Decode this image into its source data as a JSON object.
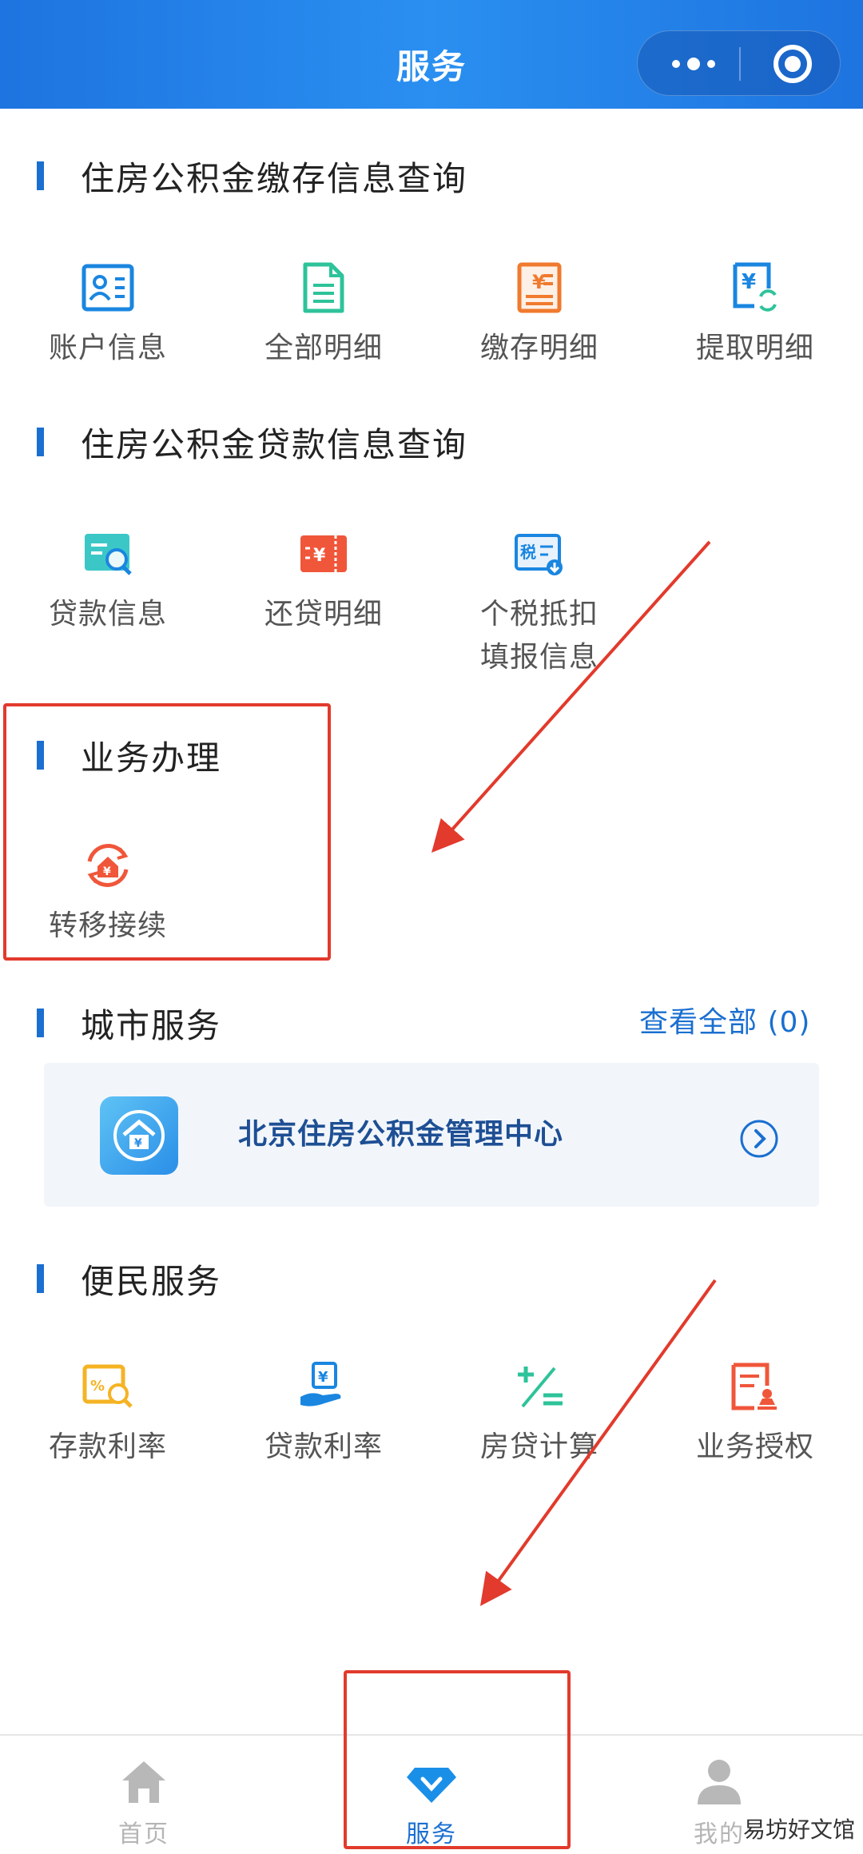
{
  "header": {
    "title": "服务"
  },
  "sections": {
    "deposit": {
      "title": "住房公积金缴存信息查询",
      "items": [
        {
          "label": "账户信息",
          "icon": "account-card-icon"
        },
        {
          "label": "全部明细",
          "icon": "document-icon"
        },
        {
          "label": "缴存明细",
          "icon": "yuan-ledger-icon"
        },
        {
          "label": "提取明细",
          "icon": "yuan-refresh-icon"
        }
      ]
    },
    "loan": {
      "title": "住房公积金贷款信息查询",
      "items": [
        {
          "label": "贷款信息",
          "icon": "search-card-icon"
        },
        {
          "label": "还贷明细",
          "icon": "yuan-ticket-icon"
        },
        {
          "label": "个税抵扣",
          "label2": "填报信息",
          "icon": "tax-download-icon"
        }
      ]
    },
    "business": {
      "title": "业务办理",
      "items": [
        {
          "label": "转移接续",
          "icon": "transfer-house-icon"
        }
      ]
    },
    "city": {
      "title": "城市服务",
      "view_all": "查看全部 (0)",
      "card_name": "北京住房公积金管理中心"
    },
    "convenience": {
      "title": "便民服务",
      "items": [
        {
          "label": "存款利率",
          "icon": "rate-search-icon"
        },
        {
          "label": "贷款利率",
          "icon": "loan-hand-icon"
        },
        {
          "label": "房贷计算",
          "icon": "calculator-icon"
        },
        {
          "label": "业务授权",
          "icon": "authorize-stamp-icon"
        }
      ]
    }
  },
  "tabbar": {
    "items": [
      {
        "label": "首页",
        "icon": "home-icon"
      },
      {
        "label": "服务",
        "icon": "service-diamond-icon",
        "active": true
      },
      {
        "label": "我的",
        "icon": "user-icon"
      }
    ]
  },
  "watermark": "易坊好文馆",
  "colors": {
    "header": "#2a8ff0",
    "accent": "#1a6fd0",
    "annotation": "#e23a2c"
  }
}
